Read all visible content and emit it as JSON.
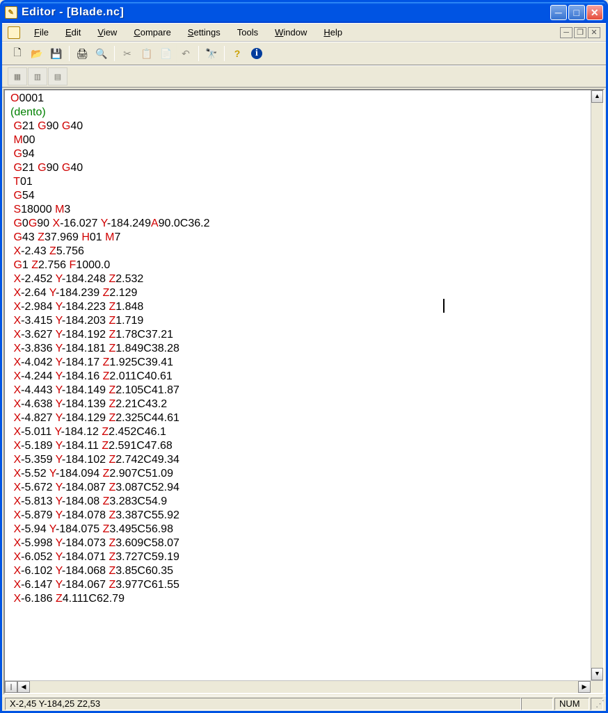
{
  "window": {
    "title": "Editor - [Blade.nc]"
  },
  "menus": {
    "file": "File",
    "edit": "Edit",
    "view": "View",
    "compare": "Compare",
    "settings": "Settings",
    "tools": "Tools",
    "window": "Window",
    "help": "Help"
  },
  "toolbar": {
    "new": "new-file",
    "open": "open-file",
    "save": "save-file",
    "print": "print",
    "preview": "print-preview",
    "cut": "cut",
    "copy": "copy",
    "paste": "paste",
    "undo": "undo",
    "find": "find",
    "help": "help",
    "about": "about"
  },
  "code_lines": [
    [
      {
        "c": "r",
        "t": "O"
      },
      {
        "c": "k",
        "t": "0001"
      }
    ],
    [
      {
        "c": "g",
        "t": "(dento)"
      }
    ],
    [
      {
        "c": "k",
        "t": " "
      },
      {
        "c": "r",
        "t": "G"
      },
      {
        "c": "k",
        "t": "21 "
      },
      {
        "c": "r",
        "t": "G"
      },
      {
        "c": "k",
        "t": "90 "
      },
      {
        "c": "r",
        "t": "G"
      },
      {
        "c": "k",
        "t": "40"
      }
    ],
    [
      {
        "c": "k",
        "t": " "
      },
      {
        "c": "r",
        "t": "M"
      },
      {
        "c": "k",
        "t": "00"
      }
    ],
    [
      {
        "c": "k",
        "t": " "
      },
      {
        "c": "r",
        "t": "G"
      },
      {
        "c": "k",
        "t": "94"
      }
    ],
    [
      {
        "c": "k",
        "t": " "
      },
      {
        "c": "r",
        "t": "G"
      },
      {
        "c": "k",
        "t": "21 "
      },
      {
        "c": "r",
        "t": "G"
      },
      {
        "c": "k",
        "t": "90 "
      },
      {
        "c": "r",
        "t": "G"
      },
      {
        "c": "k",
        "t": "40"
      }
    ],
    [
      {
        "c": "k",
        "t": " "
      },
      {
        "c": "r",
        "t": "T"
      },
      {
        "c": "k",
        "t": "01"
      }
    ],
    [
      {
        "c": "k",
        "t": " "
      },
      {
        "c": "r",
        "t": "G"
      },
      {
        "c": "k",
        "t": "54"
      }
    ],
    [
      {
        "c": "k",
        "t": " "
      },
      {
        "c": "r",
        "t": "S"
      },
      {
        "c": "k",
        "t": "18000 "
      },
      {
        "c": "r",
        "t": "M"
      },
      {
        "c": "k",
        "t": "3"
      }
    ],
    [
      {
        "c": "k",
        "t": " "
      },
      {
        "c": "r",
        "t": "G"
      },
      {
        "c": "k",
        "t": "0"
      },
      {
        "c": "r",
        "t": "G"
      },
      {
        "c": "k",
        "t": "90 "
      },
      {
        "c": "r",
        "t": "X"
      },
      {
        "c": "k",
        "t": "-16.027 "
      },
      {
        "c": "r",
        "t": "Y"
      },
      {
        "c": "k",
        "t": "-184.249"
      },
      {
        "c": "r",
        "t": "A"
      },
      {
        "c": "k",
        "t": "90.0C36.2"
      }
    ],
    [
      {
        "c": "k",
        "t": " "
      },
      {
        "c": "r",
        "t": "G"
      },
      {
        "c": "k",
        "t": "43 "
      },
      {
        "c": "r",
        "t": "Z"
      },
      {
        "c": "k",
        "t": "37.969 "
      },
      {
        "c": "r",
        "t": "H"
      },
      {
        "c": "k",
        "t": "01 "
      },
      {
        "c": "r",
        "t": "M"
      },
      {
        "c": "k",
        "t": "7"
      }
    ],
    [
      {
        "c": "k",
        "t": " "
      },
      {
        "c": "r",
        "t": "X"
      },
      {
        "c": "k",
        "t": "-2.43 "
      },
      {
        "c": "r",
        "t": "Z"
      },
      {
        "c": "k",
        "t": "5.756"
      }
    ],
    [
      {
        "c": "k",
        "t": " "
      },
      {
        "c": "r",
        "t": "G"
      },
      {
        "c": "k",
        "t": "1 "
      },
      {
        "c": "r",
        "t": "Z"
      },
      {
        "c": "k",
        "t": "2.756 "
      },
      {
        "c": "r",
        "t": "F"
      },
      {
        "c": "k",
        "t": "1000.0"
      }
    ],
    [
      {
        "c": "k",
        "t": " "
      },
      {
        "c": "r",
        "t": "X"
      },
      {
        "c": "k",
        "t": "-2.452 "
      },
      {
        "c": "r",
        "t": "Y"
      },
      {
        "c": "k",
        "t": "-184.248 "
      },
      {
        "c": "r",
        "t": "Z"
      },
      {
        "c": "k",
        "t": "2.532"
      }
    ],
    [
      {
        "c": "k",
        "t": " "
      },
      {
        "c": "r",
        "t": "X"
      },
      {
        "c": "k",
        "t": "-2.64 "
      },
      {
        "c": "r",
        "t": "Y"
      },
      {
        "c": "k",
        "t": "-184.239 "
      },
      {
        "c": "r",
        "t": "Z"
      },
      {
        "c": "k",
        "t": "2.129"
      }
    ],
    [
      {
        "c": "k",
        "t": " "
      },
      {
        "c": "r",
        "t": "X"
      },
      {
        "c": "k",
        "t": "-2.984 "
      },
      {
        "c": "r",
        "t": "Y"
      },
      {
        "c": "k",
        "t": "-184.223 "
      },
      {
        "c": "r",
        "t": "Z"
      },
      {
        "c": "k",
        "t": "1.848"
      }
    ],
    [
      {
        "c": "k",
        "t": " "
      },
      {
        "c": "r",
        "t": "X"
      },
      {
        "c": "k",
        "t": "-3.415 "
      },
      {
        "c": "r",
        "t": "Y"
      },
      {
        "c": "k",
        "t": "-184.203 "
      },
      {
        "c": "r",
        "t": "Z"
      },
      {
        "c": "k",
        "t": "1.719"
      }
    ],
    [
      {
        "c": "k",
        "t": " "
      },
      {
        "c": "r",
        "t": "X"
      },
      {
        "c": "k",
        "t": "-3.627 "
      },
      {
        "c": "r",
        "t": "Y"
      },
      {
        "c": "k",
        "t": "-184.192 "
      },
      {
        "c": "r",
        "t": "Z"
      },
      {
        "c": "k",
        "t": "1.78C37.21"
      }
    ],
    [
      {
        "c": "k",
        "t": " "
      },
      {
        "c": "r",
        "t": "X"
      },
      {
        "c": "k",
        "t": "-3.836 "
      },
      {
        "c": "r",
        "t": "Y"
      },
      {
        "c": "k",
        "t": "-184.181 "
      },
      {
        "c": "r",
        "t": "Z"
      },
      {
        "c": "k",
        "t": "1.849C38.28"
      }
    ],
    [
      {
        "c": "k",
        "t": " "
      },
      {
        "c": "r",
        "t": "X"
      },
      {
        "c": "k",
        "t": "-4.042 "
      },
      {
        "c": "r",
        "t": "Y"
      },
      {
        "c": "k",
        "t": "-184.17 "
      },
      {
        "c": "r",
        "t": "Z"
      },
      {
        "c": "k",
        "t": "1.925C39.41"
      }
    ],
    [
      {
        "c": "k",
        "t": " "
      },
      {
        "c": "r",
        "t": "X"
      },
      {
        "c": "k",
        "t": "-4.244 "
      },
      {
        "c": "r",
        "t": "Y"
      },
      {
        "c": "k",
        "t": "-184.16 "
      },
      {
        "c": "r",
        "t": "Z"
      },
      {
        "c": "k",
        "t": "2.011C40.61"
      }
    ],
    [
      {
        "c": "k",
        "t": " "
      },
      {
        "c": "r",
        "t": "X"
      },
      {
        "c": "k",
        "t": "-4.443 "
      },
      {
        "c": "r",
        "t": "Y"
      },
      {
        "c": "k",
        "t": "-184.149 "
      },
      {
        "c": "r",
        "t": "Z"
      },
      {
        "c": "k",
        "t": "2.105C41.87"
      }
    ],
    [
      {
        "c": "k",
        "t": " "
      },
      {
        "c": "r",
        "t": "X"
      },
      {
        "c": "k",
        "t": "-4.638 "
      },
      {
        "c": "r",
        "t": "Y"
      },
      {
        "c": "k",
        "t": "-184.139 "
      },
      {
        "c": "r",
        "t": "Z"
      },
      {
        "c": "k",
        "t": "2.21C43.2"
      }
    ],
    [
      {
        "c": "k",
        "t": " "
      },
      {
        "c": "r",
        "t": "X"
      },
      {
        "c": "k",
        "t": "-4.827 "
      },
      {
        "c": "r",
        "t": "Y"
      },
      {
        "c": "k",
        "t": "-184.129 "
      },
      {
        "c": "r",
        "t": "Z"
      },
      {
        "c": "k",
        "t": "2.325C44.61"
      }
    ],
    [
      {
        "c": "k",
        "t": " "
      },
      {
        "c": "r",
        "t": "X"
      },
      {
        "c": "k",
        "t": "-5.011 "
      },
      {
        "c": "r",
        "t": "Y"
      },
      {
        "c": "k",
        "t": "-184.12 "
      },
      {
        "c": "r",
        "t": "Z"
      },
      {
        "c": "k",
        "t": "2.452C46.1"
      }
    ],
    [
      {
        "c": "k",
        "t": " "
      },
      {
        "c": "r",
        "t": "X"
      },
      {
        "c": "k",
        "t": "-5.189 "
      },
      {
        "c": "r",
        "t": "Y"
      },
      {
        "c": "k",
        "t": "-184.11 "
      },
      {
        "c": "r",
        "t": "Z"
      },
      {
        "c": "k",
        "t": "2.591C47.68"
      }
    ],
    [
      {
        "c": "k",
        "t": " "
      },
      {
        "c": "r",
        "t": "X"
      },
      {
        "c": "k",
        "t": "-5.359 "
      },
      {
        "c": "r",
        "t": "Y"
      },
      {
        "c": "k",
        "t": "-184.102 "
      },
      {
        "c": "r",
        "t": "Z"
      },
      {
        "c": "k",
        "t": "2.742C49.34"
      }
    ],
    [
      {
        "c": "k",
        "t": " "
      },
      {
        "c": "r",
        "t": "X"
      },
      {
        "c": "k",
        "t": "-5.52 "
      },
      {
        "c": "r",
        "t": "Y"
      },
      {
        "c": "k",
        "t": "-184.094 "
      },
      {
        "c": "r",
        "t": "Z"
      },
      {
        "c": "k",
        "t": "2.907C51.09"
      }
    ],
    [
      {
        "c": "k",
        "t": " "
      },
      {
        "c": "r",
        "t": "X"
      },
      {
        "c": "k",
        "t": "-5.672 "
      },
      {
        "c": "r",
        "t": "Y"
      },
      {
        "c": "k",
        "t": "-184.087 "
      },
      {
        "c": "r",
        "t": "Z"
      },
      {
        "c": "k",
        "t": "3.087C52.94"
      }
    ],
    [
      {
        "c": "k",
        "t": " "
      },
      {
        "c": "r",
        "t": "X"
      },
      {
        "c": "k",
        "t": "-5.813 "
      },
      {
        "c": "r",
        "t": "Y"
      },
      {
        "c": "k",
        "t": "-184.08 "
      },
      {
        "c": "r",
        "t": "Z"
      },
      {
        "c": "k",
        "t": "3.283C54.9"
      }
    ],
    [
      {
        "c": "k",
        "t": " "
      },
      {
        "c": "r",
        "t": "X"
      },
      {
        "c": "k",
        "t": "-5.879 "
      },
      {
        "c": "r",
        "t": "Y"
      },
      {
        "c": "k",
        "t": "-184.078 "
      },
      {
        "c": "r",
        "t": "Z"
      },
      {
        "c": "k",
        "t": "3.387C55.92"
      }
    ],
    [
      {
        "c": "k",
        "t": " "
      },
      {
        "c": "r",
        "t": "X"
      },
      {
        "c": "k",
        "t": "-5.94 "
      },
      {
        "c": "r",
        "t": "Y"
      },
      {
        "c": "k",
        "t": "-184.075 "
      },
      {
        "c": "r",
        "t": "Z"
      },
      {
        "c": "k",
        "t": "3.495C56.98"
      }
    ],
    [
      {
        "c": "k",
        "t": " "
      },
      {
        "c": "r",
        "t": "X"
      },
      {
        "c": "k",
        "t": "-5.998 "
      },
      {
        "c": "r",
        "t": "Y"
      },
      {
        "c": "k",
        "t": "-184.073 "
      },
      {
        "c": "r",
        "t": "Z"
      },
      {
        "c": "k",
        "t": "3.609C58.07"
      }
    ],
    [
      {
        "c": "k",
        "t": " "
      },
      {
        "c": "r",
        "t": "X"
      },
      {
        "c": "k",
        "t": "-6.052 "
      },
      {
        "c": "r",
        "t": "Y"
      },
      {
        "c": "k",
        "t": "-184.071 "
      },
      {
        "c": "r",
        "t": "Z"
      },
      {
        "c": "k",
        "t": "3.727C59.19"
      }
    ],
    [
      {
        "c": "k",
        "t": " "
      },
      {
        "c": "r",
        "t": "X"
      },
      {
        "c": "k",
        "t": "-6.102 "
      },
      {
        "c": "r",
        "t": "Y"
      },
      {
        "c": "k",
        "t": "-184.068 "
      },
      {
        "c": "r",
        "t": "Z"
      },
      {
        "c": "k",
        "t": "3.85C60.35"
      }
    ],
    [
      {
        "c": "k",
        "t": " "
      },
      {
        "c": "r",
        "t": "X"
      },
      {
        "c": "k",
        "t": "-6.147 "
      },
      {
        "c": "r",
        "t": "Y"
      },
      {
        "c": "k",
        "t": "-184.067 "
      },
      {
        "c": "r",
        "t": "Z"
      },
      {
        "c": "k",
        "t": "3.977C61.55"
      }
    ],
    [
      {
        "c": "k",
        "t": " "
      },
      {
        "c": "r",
        "t": "X"
      },
      {
        "c": "k",
        "t": "-6.186 "
      },
      {
        "c": "r",
        "t": "Z"
      },
      {
        "c": "k",
        "t": "4.111C62.79"
      }
    ]
  ],
  "status": {
    "coords": "X-2,45 Y-184,25 Z2,53",
    "num": "NUM"
  }
}
